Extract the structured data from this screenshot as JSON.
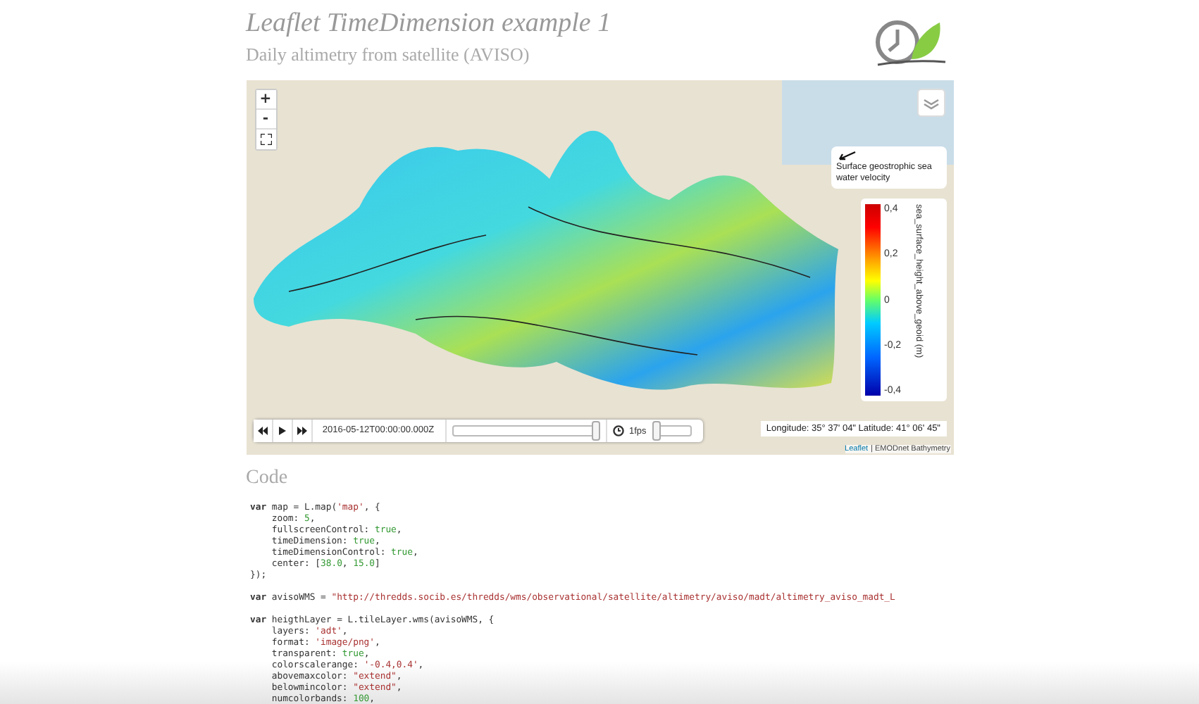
{
  "header": {
    "title": "Leaflet TimeDimension example 1",
    "subtitle": "Daily altimetry from satellite (AVISO)"
  },
  "map": {
    "zoom_controls": [
      "+",
      "-"
    ],
    "velocity_legend": "Surface geostrophic sea water velocity",
    "color_legend": {
      "title": "sea_surface_height_above_geoid (m)",
      "ticks": [
        "0,4",
        "0,2",
        "0",
        "-0,2",
        "-0,4"
      ]
    },
    "coordinates": "Longitude: 35° 37' 04\" Latitude: 41° 06' 45\"",
    "attribution": {
      "link": "Leaflet",
      "text": "| EMODnet Bathymetry"
    },
    "time_control": {
      "date": "2016-05-12T00:00:00.000Z",
      "time_slider": {
        "level": 0.98
      },
      "speed": "1fps",
      "speed_slider": {
        "level": 0.05
      }
    }
  },
  "code_section": {
    "heading": "Code",
    "blocks": [
      [
        [
          {
            "kind": "kw",
            "text": "var"
          },
          {
            "kind": "plain",
            "text": " map = L.map("
          },
          {
            "kind": "str",
            "text": "'map'"
          },
          {
            "kind": "plain",
            "text": ", {"
          }
        ],
        [
          {
            "kind": "plain",
            "text": "    zoom: "
          },
          {
            "kind": "val",
            "text": "5"
          },
          {
            "kind": "plain",
            "text": ","
          }
        ],
        [
          {
            "kind": "plain",
            "text": "    fullscreenControl: "
          },
          {
            "kind": "val",
            "text": "true"
          },
          {
            "kind": "plain",
            "text": ","
          }
        ],
        [
          {
            "kind": "plain",
            "text": "    timeDimension: "
          },
          {
            "kind": "val",
            "text": "true"
          },
          {
            "kind": "plain",
            "text": ","
          }
        ],
        [
          {
            "kind": "plain",
            "text": "    timeDimensionControl: "
          },
          {
            "kind": "val",
            "text": "true"
          },
          {
            "kind": "plain",
            "text": ","
          }
        ],
        [
          {
            "kind": "plain",
            "text": "    center: ["
          },
          {
            "kind": "val",
            "text": "38.0"
          },
          {
            "kind": "plain",
            "text": ", "
          },
          {
            "kind": "val",
            "text": "15.0"
          },
          {
            "kind": "plain",
            "text": "]"
          }
        ],
        [
          {
            "kind": "plain",
            "text": "});"
          }
        ]
      ],
      [
        [
          {
            "kind": "kw",
            "text": "var"
          },
          {
            "kind": "plain",
            "text": " avisoWMS = "
          },
          {
            "kind": "str",
            "text": "\"http://thredds.socib.es/thredds/wms/observational/satellite/altimetry/aviso/madt/altimetry_aviso_madt_L"
          }
        ]
      ],
      [
        [
          {
            "kind": "kw",
            "text": "var"
          },
          {
            "kind": "plain",
            "text": " heigthLayer = L.tileLayer.wms(avisoWMS, {"
          }
        ],
        [
          {
            "kind": "plain",
            "text": "    layers: "
          },
          {
            "kind": "str",
            "text": "'adt'"
          },
          {
            "kind": "plain",
            "text": ","
          }
        ],
        [
          {
            "kind": "plain",
            "text": "    format: "
          },
          {
            "kind": "str",
            "text": "'image/png'"
          },
          {
            "kind": "plain",
            "text": ","
          }
        ],
        [
          {
            "kind": "plain",
            "text": "    transparent: "
          },
          {
            "kind": "val",
            "text": "true"
          },
          {
            "kind": "plain",
            "text": ","
          }
        ],
        [
          {
            "kind": "plain",
            "text": "    colorscalerange: "
          },
          {
            "kind": "str",
            "text": "'-0.4,0.4'"
          },
          {
            "kind": "plain",
            "text": ","
          }
        ],
        [
          {
            "kind": "plain",
            "text": "    abovemaxcolor: "
          },
          {
            "kind": "str",
            "text": "\"extend\""
          },
          {
            "kind": "plain",
            "text": ","
          }
        ],
        [
          {
            "kind": "plain",
            "text": "    belowmincolor: "
          },
          {
            "kind": "str",
            "text": "\"extend\""
          },
          {
            "kind": "plain",
            "text": ","
          }
        ],
        [
          {
            "kind": "plain",
            "text": "    numcolorbands: "
          },
          {
            "kind": "val",
            "text": "100"
          },
          {
            "kind": "plain",
            "text": ","
          }
        ]
      ]
    ]
  }
}
